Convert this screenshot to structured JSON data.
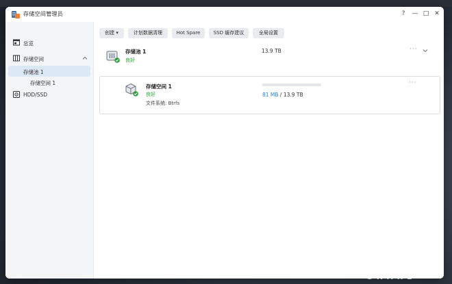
{
  "window": {
    "title": "存储空间管理员",
    "help_label": "?",
    "minimize_label": "—",
    "maximize_label": "□",
    "close_label": "✕"
  },
  "sidebar": {
    "overview": "总览",
    "storage": "存储空间",
    "pool": "存储池 1",
    "volume": "存储空间 1",
    "hdd": "HDD/SSD"
  },
  "toolbar": {
    "create": "创建 ▾",
    "schedule": "计划数据清理",
    "hotspare": "Hot Spare",
    "ssd_cache": "SSD 缓存建议",
    "global": "全局设置"
  },
  "pool": {
    "name": "存储池 1",
    "status": "良好",
    "size": "13.9 TB"
  },
  "volume": {
    "name": "存储空间 1",
    "status": "良好",
    "filesystem": "文件系统: Btrfs",
    "used": "81 MB",
    "separator": " / ",
    "total": "13.9 TB",
    "usage_fraction": 0.0
  },
  "watermark": {
    "brand": "KOOL SHARE"
  },
  "colors": {
    "accent": "#3a86d6",
    "status_good": "#2e9e3a",
    "sidebar_active": "#dbe8f6"
  },
  "icons": {
    "app": "storage-manager-icon",
    "overview": "overview-icon",
    "storage": "storage-icon",
    "hdd": "hdd-icon"
  }
}
